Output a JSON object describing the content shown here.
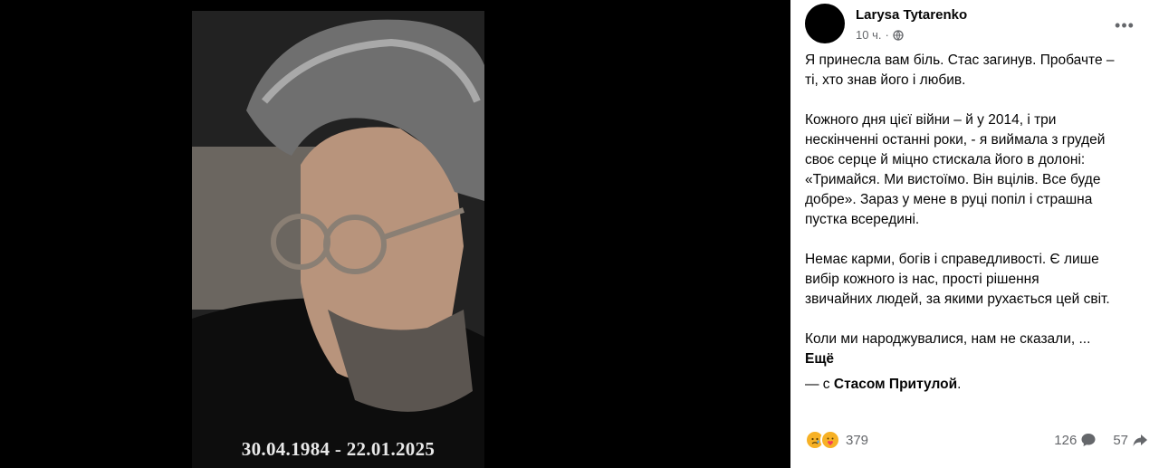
{
  "photo": {
    "caption": "30.04.1984 - 22.01.2025"
  },
  "post": {
    "author": "Larysa Tytarenko",
    "time": "10 ч.",
    "separator": "·",
    "paragraphs": [
      "Я принесла вам біль. Стас загинув. Пробачте –\nті, хто знав його і любив.",
      "Кожного дня цієї війни – й у 2014, і три\nнескінченні останні роки, - я виймала з грудей\nсвоє серце й міцно стискала його в долоні:\n«Тримайся. Ми вистоїмо. Він вцілів. Все буде\nдобре». Зараз у мене в руці попіл і страшна\nпустка всередині.",
      "Немає карми, богів і справедливості. Є лише\nвибір кожного із нас, прості рішення\nзвичайних людей, за якими рухається цей світ.",
      "Коли ми народжувалися, нам не сказали, ..."
    ],
    "see_more": "Ещё",
    "tag_prefix": "— с ",
    "tag_name": "Стасом Притулой",
    "tag_suffix": "."
  },
  "stats": {
    "reactions_count": "379",
    "comments_count": "126",
    "shares_count": "57"
  },
  "icons": {
    "more": "more-options-icon",
    "globe": "globe-icon",
    "comment": "comment-icon",
    "share": "share-icon"
  }
}
